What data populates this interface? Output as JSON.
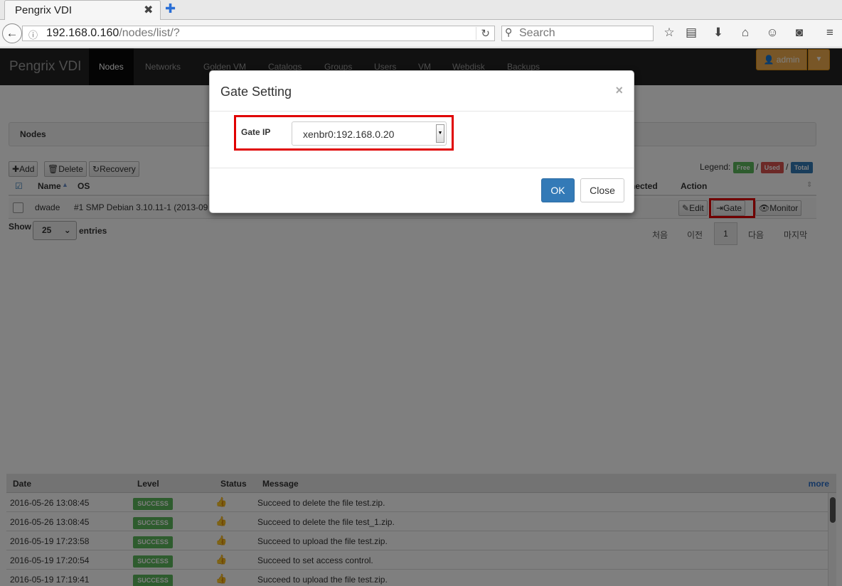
{
  "browser": {
    "tab_title": "Pengrix VDI",
    "tab_close": "✖",
    "new_tab": "✚",
    "url_host": "192.168.0.160",
    "url_path": "/nodes/list/?",
    "search_placeholder": "Search"
  },
  "appnav": {
    "brand": "Pengrix VDI",
    "items": [
      "Nodes",
      "Networks",
      "Golden VM",
      "Catalogs",
      "Groups",
      "Users",
      "VM",
      "Webdisk",
      "Backups"
    ],
    "active": "Nodes",
    "admin_label": "admin"
  },
  "page": {
    "panel_title": "Nodes",
    "toolbar": {
      "add": "Add",
      "delete": "Delete",
      "recovery": "Recovery"
    },
    "legend": {
      "label": "Legend:",
      "free": "Free",
      "used": "Used",
      "total": "Total",
      "sep": "/"
    },
    "columns": {
      "name": "Name",
      "os": "OS",
      "connected": "nected",
      "action": "Action"
    },
    "row": {
      "name": "dwade",
      "os": "#1 SMP Debian 3.10.11-1 (2013-09",
      "actions": {
        "edit": "Edit",
        "gate": "Gate",
        "monitor": "Monitor"
      }
    },
    "length": {
      "show": "Show",
      "value": "25",
      "entries": "entries"
    },
    "pagination": {
      "first": "처음",
      "prev": "이전",
      "current": "1",
      "next": "다음",
      "last": "마지막"
    }
  },
  "log": {
    "headers": {
      "date": "Date",
      "level": "Level",
      "status": "Status",
      "message": "Message",
      "more": "more"
    },
    "rows": [
      {
        "date": "2016-05-26 13:08:45",
        "level": "SUCCESS",
        "message": "Succeed to delete the file test.zip."
      },
      {
        "date": "2016-05-26 13:08:45",
        "level": "SUCCESS",
        "message": "Succeed to delete the file test_1.zip."
      },
      {
        "date": "2016-05-19 17:23:58",
        "level": "SUCCESS",
        "message": "Succeed to upload the file test.zip."
      },
      {
        "date": "2016-05-19 17:20:54",
        "level": "SUCCESS",
        "message": "Succeed to set access control."
      },
      {
        "date": "2016-05-19 17:19:41",
        "level": "SUCCESS",
        "message": "Succeed to upload the file test.zip."
      }
    ]
  },
  "modal": {
    "title": "Gate Setting",
    "close_glyph": "×",
    "field_label": "Gate IP",
    "field_value": "xenbr0:192.168.0.20",
    "ok": "OK",
    "close": "Close"
  },
  "colors": {
    "free": "#5cb85c",
    "used": "#d9534f",
    "total": "#337ab7",
    "highlight": "#e00000",
    "admin": "#f0ad4e"
  }
}
